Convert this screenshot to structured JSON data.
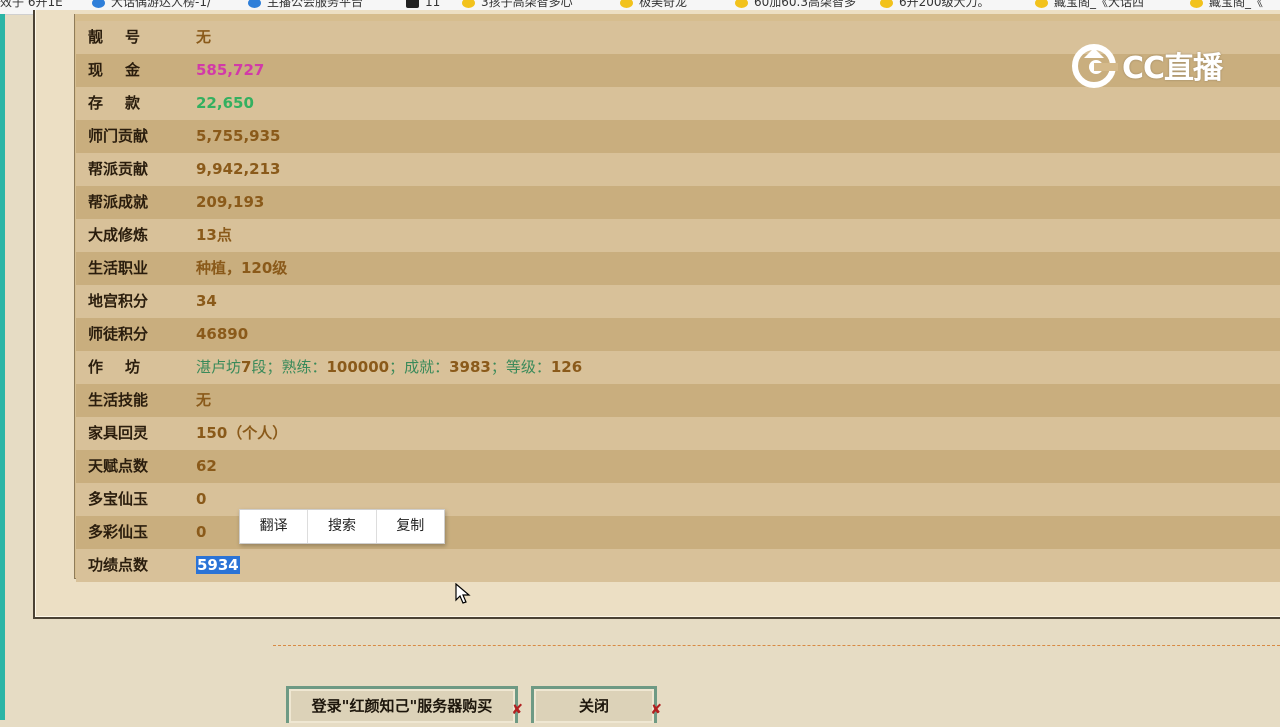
{
  "bookmarks": [
    {
      "label": "效子  6开1E",
      "icon": "none"
    },
    {
      "label": "大话偶游达人榜-1/",
      "icon": "blue"
    },
    {
      "label": "主播公会服务平台",
      "icon": "blue"
    },
    {
      "label": "11",
      "icon": "cam"
    },
    {
      "label": "3孩子高柒智多心",
      "icon": "yellow"
    },
    {
      "label": "极美奇龙",
      "icon": "yellow"
    },
    {
      "label": "60加60.3高柒智多",
      "icon": "yellow"
    },
    {
      "label": "6开200级大力。",
      "icon": "yellow"
    },
    {
      "label": "藏宝阁_《大话西",
      "icon": "yellow"
    },
    {
      "label": "藏宝阁_《",
      "icon": "yellow"
    }
  ],
  "rows": [
    {
      "label": "靓号",
      "spaced": true,
      "value": "无",
      "style": "normal"
    },
    {
      "label": "现金",
      "spaced": true,
      "value": "585,727",
      "style": "pink"
    },
    {
      "label": "存款",
      "spaced": true,
      "value": "22,650",
      "style": "green"
    },
    {
      "label": "师门贡献",
      "spaced": false,
      "value": "5,755,935",
      "style": "normal"
    },
    {
      "label": "帮派贡献",
      "spaced": false,
      "value": "9,942,213",
      "style": "normal"
    },
    {
      "label": "帮派成就",
      "spaced": false,
      "value": "209,193",
      "style": "normal"
    },
    {
      "label": "大成修炼",
      "spaced": false,
      "value": "13点",
      "style": "normal"
    },
    {
      "label": "生活职业",
      "spaced": false,
      "value": "种植，120级",
      "style": "normal"
    },
    {
      "label": "地宫积分",
      "spaced": false,
      "value": "34",
      "style": "normal"
    },
    {
      "label": "师徒积分",
      "spaced": false,
      "value": "46890",
      "style": "normal"
    },
    {
      "label": "作坊",
      "spaced": true,
      "value": "",
      "style": "workshop"
    },
    {
      "label": "生活技能",
      "spaced": false,
      "value": "无",
      "style": "normal"
    },
    {
      "label": "家具回灵",
      "spaced": false,
      "value": "150（个人）",
      "style": "normal"
    },
    {
      "label": "天赋点数",
      "spaced": false,
      "value": "62",
      "style": "normal"
    },
    {
      "label": "多宝仙玉",
      "spaced": false,
      "value": "0",
      "style": "normal"
    },
    {
      "label": "多彩仙玉",
      "spaced": false,
      "value": "0",
      "style": "normal"
    },
    {
      "label": "功绩点数",
      "spaced": false,
      "value": "5934",
      "style": "selected"
    }
  ],
  "workshop": {
    "p1": "湛卢坊",
    "n1": "7",
    "p2": "段；熟练：",
    "n2": "100000",
    "p3": "；成就：",
    "n3": "3983",
    "p4": "；等级：",
    "n4": "126"
  },
  "context_menu": {
    "translate": "翻译",
    "search": "搜索",
    "copy": "复制"
  },
  "buttons": {
    "login_server": "登录\"红颜知己\"服务器购买",
    "close": "关闭"
  },
  "watermark": {
    "text": "CC直播"
  }
}
